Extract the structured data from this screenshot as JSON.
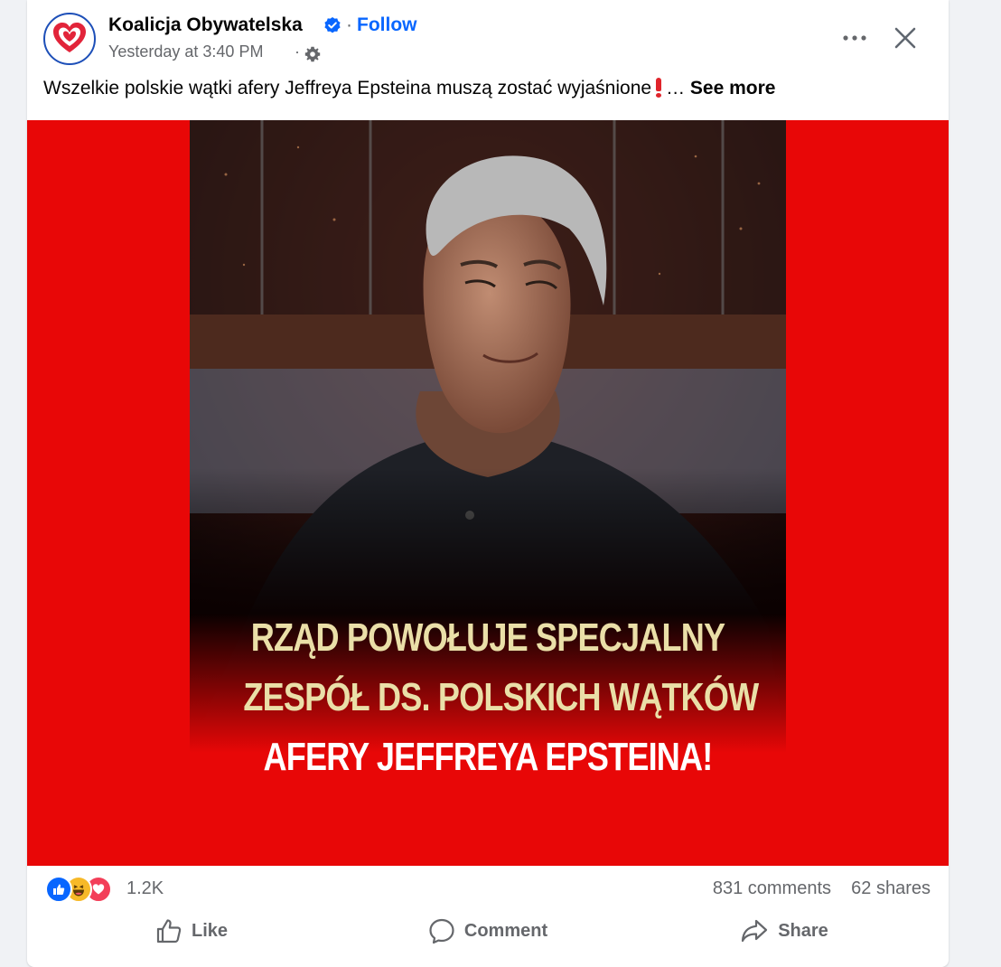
{
  "post": {
    "author": "Koalicja Obywatelska",
    "separator": "·",
    "follow_label": "Follow",
    "timestamp": "Yesterday at 3:40 PM",
    "timestamp_separator": "·",
    "text": "Wszelkie polskie wątki afery Jeffreya Epsteina muszą zostać wyjaśnione",
    "ellipsis": "…",
    "see_more_label": "See more",
    "brand_color": "#e80707",
    "accent_color": "#0866ff"
  },
  "image": {
    "headline_lines": [
      "RZĄD POWOŁUJE SPECJALNY",
      "ZESPÓŁ DS. POLSKICH WĄTKÓW",
      "AFERY JEFFREYA EPSTEINA!"
    ]
  },
  "stats": {
    "reaction_icons": [
      "like-icon",
      "haha-icon",
      "love-icon"
    ],
    "reaction_count": "1.2K",
    "comments": "831 comments",
    "shares": "62 shares"
  },
  "actions": {
    "like": "Like",
    "comment": "Comment",
    "share": "Share"
  }
}
